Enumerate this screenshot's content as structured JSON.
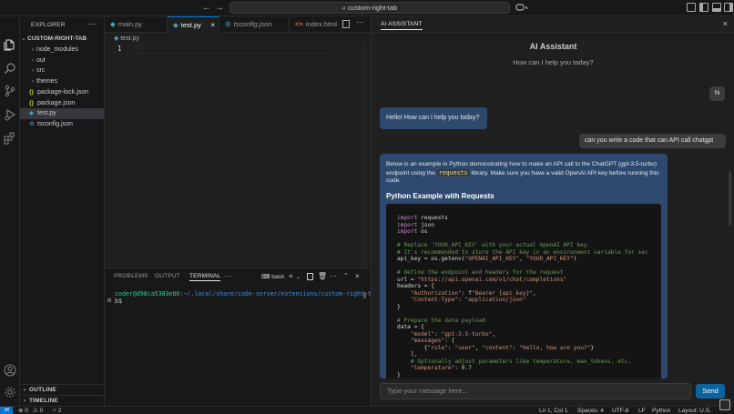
{
  "titlebar": {
    "back": "←",
    "forward": "→",
    "search": "custom-right-tab",
    "search_icon": "⌕"
  },
  "explorer": {
    "title": "EXPLORER",
    "more": "···",
    "root": "CUSTOM-RIGHT-TAB",
    "items": [
      {
        "label": "node_modules",
        "type": "folder"
      },
      {
        "label": "out",
        "type": "folder"
      },
      {
        "label": "src",
        "type": "folder"
      },
      {
        "label": "themes",
        "type": "folder"
      },
      {
        "label": "package-lock.json",
        "type": "json"
      },
      {
        "label": "package.json",
        "type": "json"
      },
      {
        "label": "test.py",
        "type": "py",
        "selected": true
      },
      {
        "label": "tsconfig.json",
        "type": "ts"
      }
    ],
    "outline": "OUTLINE",
    "timeline": "TIMELINE"
  },
  "editor": {
    "tabs": [
      {
        "label": "main.py",
        "icon": "◆"
      },
      {
        "label": "test.py",
        "icon": "◆",
        "active": true
      },
      {
        "label": "tsconfig.json",
        "icon": ""
      },
      {
        "label": "index.html",
        "icon": "<>"
      }
    ],
    "close": "×",
    "breadcrumb": "test.py",
    "line_number": "1"
  },
  "panel": {
    "tabs": [
      "PROBLEMS",
      "OUTPUT",
      "TERMINAL"
    ],
    "active_tab": "TERMINAL",
    "more": "···",
    "shell": "bash",
    "plus": "+",
    "terminal_prompt_user": "coder@d98ca5383e86",
    "terminal_prompt_path": ":~/.local/share/code-server/extensions/custom-right-ta",
    "terminal_line2": "b$"
  },
  "chat": {
    "tab_label": "AI ASSISTANT",
    "close": "×",
    "title": "AI Assistant",
    "subtitle": "How can I help you today?",
    "messages": {
      "user1": "hi",
      "ai1": "Hello! How can I help you today?",
      "user2": "can you write a code that can API call chatgpt",
      "ai2_pre": "Below is an example in Python demonstrating how to make an API call to the ChatGPT (gpt-3.5-turbo) endpoint using the ",
      "ai2_code": "requests",
      "ai2_post": " library. Make sure you have a valid OpenAI API key before running this code.",
      "ai2_heading": "Python Example with Requests",
      "code": "import requests\nimport json\nimport os\n\n# Replace 'YOUR_API_KEY' with your actual OpenAI API key.\n# It's recommended to store the API key in an environment variable for sec\napi_key = os.getenv(\"OPENAI_API_KEY\", \"YOUR_API_KEY\")\n\n# Define the endpoint and headers for the request\nurl = \"https://api.openai.com/v1/chat/completions\"\nheaders = {\n    \"Authorization\": f\"Bearer {api_key}\",\n    \"Content-Type\": \"application/json\"\n}\n\n# Prepare the data payload\ndata = {\n    \"model\": \"gpt-3.5-turbo\",\n    \"messages\": [\n        {\"role\": \"user\", \"content\": \"Hello, how are you?\"}\n    ],\n    # Optionally adjust parameters like temperature, max_tokens, etc.\n    \"temperature\": 0.7\n}"
    },
    "input_placeholder": "Type your message here...",
    "send": "Send"
  },
  "statusbar": {
    "remote": "⋊",
    "errors": "⊗ 0",
    "warnings": "⚠ 0",
    "ports": "⑂ 2",
    "position": "Ln 1, Col 1",
    "spaces": "Spaces: 4",
    "encoding": "UTF-8",
    "eol": "LF",
    "language": "Python",
    "layout": "Layout: U.S."
  }
}
